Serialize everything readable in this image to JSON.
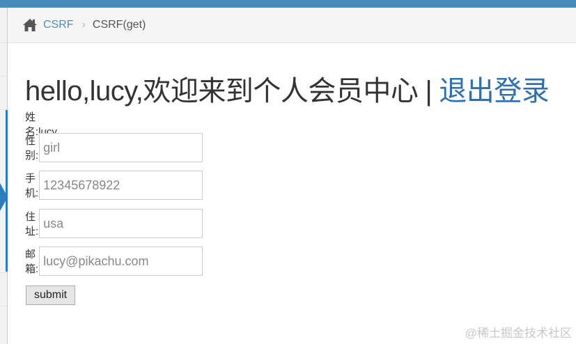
{
  "breadcrumb": {
    "home_icon": "home-icon",
    "link": "CSRF",
    "separator": "›",
    "current": "CSRF(get)"
  },
  "page": {
    "heading_main": "hello,lucy,欢迎来到个人会员中心",
    "heading_sep": "|",
    "heading_logout": "退出登录",
    "name_text": "姓名:lucy"
  },
  "form": {
    "fields": [
      {
        "label": "性别:",
        "value": "girl"
      },
      {
        "label": "手机:",
        "value": "12345678922"
      },
      {
        "label": "住址:",
        "value": "usa"
      },
      {
        "label": "邮箱:",
        "value": "lucy@pikachu.com"
      }
    ],
    "submit_label": "submit"
  },
  "watermark": "@稀土掘金技术社区",
  "colors": {
    "topbar": "#438eb9",
    "link": "#4c8fbd",
    "logout": "#2e6fb0",
    "accent": "#2b7dbc"
  }
}
